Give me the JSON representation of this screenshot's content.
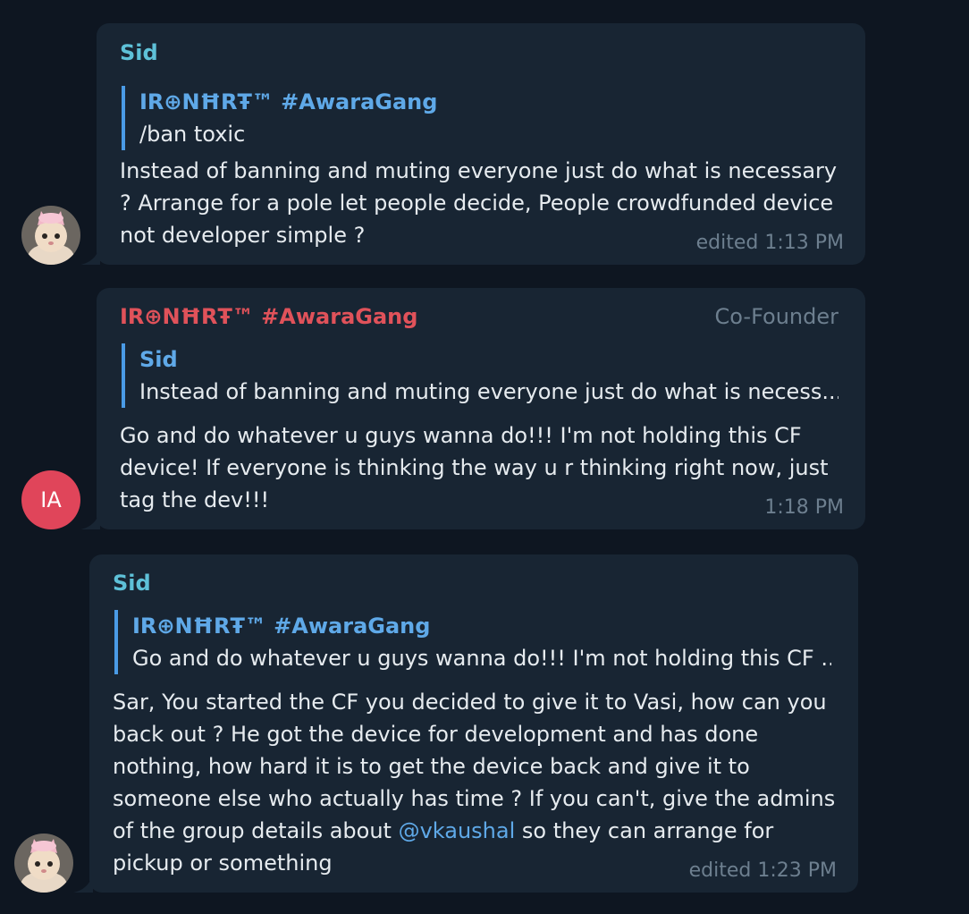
{
  "colors": {
    "background": "#0e1621",
    "bubble": "#182533",
    "sid_name": "#5ec1d8",
    "ironheart_name": "#e0525a",
    "reply_accent": "#4a9be6",
    "link": "#5fa9e8",
    "avatar_ia": "#e0455a"
  },
  "messages": [
    {
      "sender": "Sid",
      "avatar_icon": "cat-avatar-icon",
      "reply_to": {
        "name": "IR⊕NĦRŦ™ #AwaraGang",
        "text": "/ban toxic"
      },
      "text": "Instead of banning and muting everyone just do what is necessary\n? Arrange for a pole let people decide, People crowdfunded device\nnot developer simple ?",
      "time": "edited 1:13 PM"
    },
    {
      "sender": "IR⊕NĦRŦ™ #AwaraGang",
      "role": "Co-Founder",
      "avatar_initials": "IA",
      "reply_to": {
        "name": "Sid",
        "text": "Instead of banning and muting everyone just do what is necess..."
      },
      "text": "Go and do whatever u guys wanna do!!! I'm not holding this CF\ndevice! If everyone is thinking the way u r thinking right now, just\ntag the dev!!!",
      "time": "1:18 PM"
    },
    {
      "sender": "Sid",
      "avatar_icon": "cat-avatar-icon",
      "reply_to": {
        "name": "IR⊕NĦRŦ™ #AwaraGang",
        "text": "Go and do whatever u guys wanna do!!! I'm not holding this CF ..."
      },
      "text_before_mention": "Sar, You started the CF you decided to give it to Vasi, how can you\nback out ? He got the device for development and has done\nnothing, how hard it is to get the device back and give it to\nsomeone else who actually has time ? If you can't, give the admins\nof the group details about ",
      "mention": "@vkaushal",
      "text_after_mention": " so they can arrange for\npickup or something",
      "time": "edited 1:23 PM"
    }
  ]
}
